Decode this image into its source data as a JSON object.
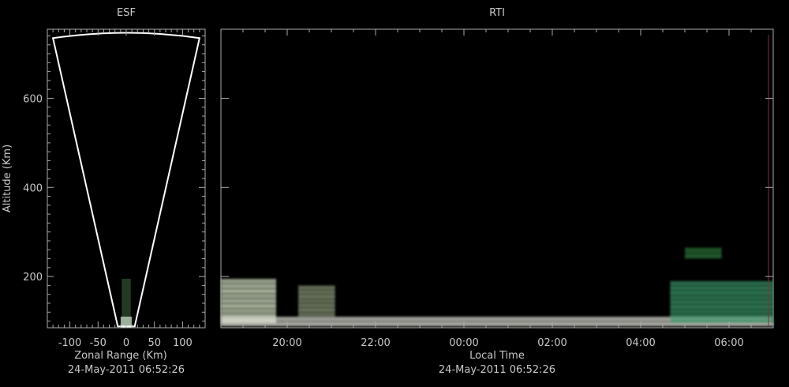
{
  "chart_data": [
    {
      "type": "heatmap",
      "title": "ESF",
      "xlabel": "Zonal Range (Km)",
      "ylabel": "Altitude (Km)",
      "timestamp": "24-May-2011 06:52:26",
      "xlim": [
        -140,
        140
      ],
      "ylim": [
        85,
        755
      ],
      "xticks": [
        -100,
        -50,
        0,
        50,
        100
      ],
      "xtick_labels": [
        "-100",
        "-50",
        "0",
        "50",
        "100"
      ],
      "yticks": [
        200,
        400,
        600
      ],
      "ytick_labels": [
        "200",
        "400",
        "600"
      ],
      "fan": {
        "apex_range_min": -15,
        "apex_range_max": 15,
        "apex_altitude": 88,
        "top_range_min": -130,
        "top_range_max": 130,
        "top_altitude": 735,
        "arc_peak_altitude": 747
      },
      "echo_altitude_range": [
        85,
        195
      ]
    },
    {
      "type": "heatmap",
      "title": "RTI",
      "xlabel": "Local Time",
      "ylabel": "",
      "timestamp": "24-May-2011 06:52:26",
      "xlim": [
        "18:30",
        "07:00"
      ],
      "ylim": [
        85,
        755
      ],
      "xticks": [
        "20:00",
        "22:00",
        "00:00",
        "02:00",
        "04:00",
        "06:00"
      ],
      "yticks": [
        200,
        400,
        600
      ],
      "echo_layers": [
        {
          "start": "18:30",
          "end": "19:45",
          "altitude_min": 95,
          "altitude_max": 195,
          "color": "#d8e8c8"
        },
        {
          "start": "18:30",
          "end": "07:00",
          "altitude_min": 88,
          "altitude_max": 110,
          "color": "#e8e8e0"
        },
        {
          "start": "20:15",
          "end": "21:05",
          "altitude_min": 110,
          "altitude_max": 180,
          "color": "#8a9a78"
        },
        {
          "start": "04:40",
          "end": "07:00",
          "altitude_min": 95,
          "altitude_max": 190,
          "color": "#3a9a6a"
        },
        {
          "start": "05:00",
          "end": "05:50",
          "altitude_min": 240,
          "altitude_max": 265,
          "color": "#2f7a3a"
        }
      ]
    }
  ]
}
